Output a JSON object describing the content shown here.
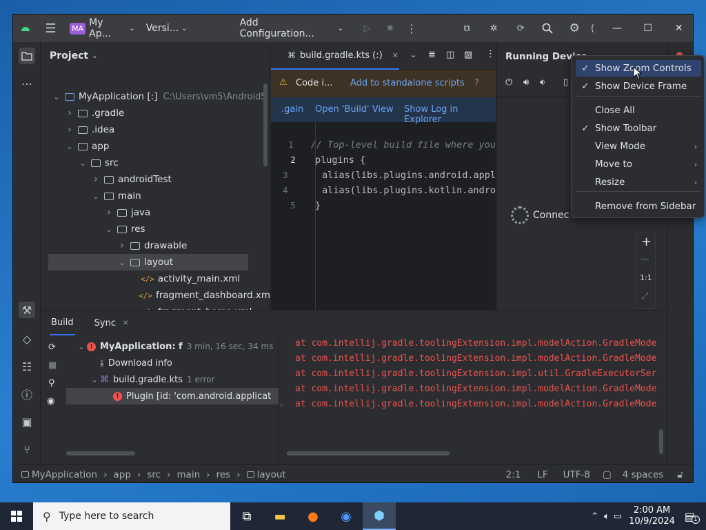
{
  "titlebar": {
    "project_badge": "MA",
    "project_name": "My Ap...",
    "vcs": "Versi...",
    "run_config": "Add Configuration..."
  },
  "project_panel": {
    "title": "Project",
    "root": "MyApplication [:]",
    "root_path": "C:\\Users\\vm5\\AndroidS",
    "items": [
      {
        "label": ".gradle",
        "level": 1,
        "expand": "closed",
        "icon": "folder-icon"
      },
      {
        "label": ".idea",
        "level": 1,
        "expand": "closed",
        "icon": "folder-icon"
      },
      {
        "label": "app",
        "level": 1,
        "expand": "open",
        "icon": "folder-icon"
      },
      {
        "label": "src",
        "level": 2,
        "expand": "open",
        "icon": "folder-icon"
      },
      {
        "label": "androidTest",
        "level": 3,
        "expand": "closed",
        "icon": "folder-icon"
      },
      {
        "label": "main",
        "level": 3,
        "expand": "open",
        "icon": "folder-icon"
      },
      {
        "label": "java",
        "level": 4,
        "expand": "closed",
        "icon": "folder-icon"
      },
      {
        "label": "res",
        "level": 4,
        "expand": "open",
        "icon": "folder-icon"
      },
      {
        "label": "drawable",
        "level": 5,
        "expand": "closed",
        "icon": "folder-icon"
      },
      {
        "label": "layout",
        "level": 5,
        "expand": "open",
        "icon": "folder-icon",
        "selected": true
      },
      {
        "label": "activity_main.xml",
        "level": 6,
        "expand": "none",
        "icon": "xml-icon"
      },
      {
        "label": "fragment_dashboard.xm",
        "level": 6,
        "expand": "none",
        "icon": "xml-icon"
      },
      {
        "label": "fragment_home.xml",
        "level": 6,
        "expand": "none",
        "icon": "xml-icon"
      }
    ]
  },
  "editor": {
    "tab_label": "build.gradle.kts (:)",
    "warning_text": "Code i...",
    "warning_link": "Add to standalone scripts",
    "actions": [
      ".gain",
      "Open 'Build' View",
      "Show Log in Explorer"
    ],
    "lines": [
      {
        "n": "1",
        "code": "// Top-level build file where you",
        "comment": true
      },
      {
        "n": "2",
        "code": "plugins {",
        "comment": false
      },
      {
        "n": "3",
        "code": "    alias(libs.plugins.android.appl",
        "comment": false
      },
      {
        "n": "4",
        "code": "    alias(libs.plugins.kotlin.andro",
        "comment": false
      },
      {
        "n": "5",
        "code": "}",
        "comment": false
      }
    ]
  },
  "running_devices": {
    "title": "Running Device",
    "status": "Connec",
    "zoom_plus": "+",
    "zoom_minus": "—",
    "zoom_actual": "1:1"
  },
  "context_menu": {
    "items": [
      {
        "label": "Show Zoom Controls",
        "checked": true,
        "submenu": false,
        "highlight": true
      },
      {
        "label": "Show Device Frame",
        "checked": true,
        "submenu": false,
        "highlight": false
      },
      {
        "label": "Close All",
        "checked": false,
        "submenu": false,
        "highlight": false
      },
      {
        "label": "Show Toolbar",
        "checked": true,
        "submenu": false,
        "highlight": false
      },
      {
        "label": "View Mode",
        "checked": false,
        "submenu": true,
        "highlight": false
      },
      {
        "label": "Move to",
        "checked": false,
        "submenu": true,
        "highlight": false
      },
      {
        "label": "Resize",
        "checked": false,
        "submenu": true,
        "highlight": false
      },
      {
        "label": "Remove from Sidebar",
        "checked": false,
        "submenu": false,
        "highlight": false
      }
    ]
  },
  "build_panel": {
    "tabs": [
      "Build",
      "Sync"
    ],
    "tree": [
      {
        "label": "MyApplication: f",
        "meta": "3 min, 16 sec, 34 ms",
        "icon": "error-icon",
        "level": 0
      },
      {
        "label": "Download info",
        "meta": "",
        "icon": "download-icon",
        "level": 1
      },
      {
        "label": "build.gradle.kts",
        "meta": "1 error",
        "icon": "gradle-file-icon",
        "level": 1
      },
      {
        "label": "Plugin [id: 'com.android.applicat",
        "meta": "",
        "icon": "error-icon",
        "level": 2
      }
    ],
    "log_lines": [
      "at com.intellij.gradle.toolingExtension.impl.modelAction.GradleMode",
      "at com.intellij.gradle.toolingExtension.impl.modelAction.GradleMode",
      "at com.intellij.gradle.toolingExtension.impl.util.GradleExecutorSer",
      "at com.intellij.gradle.toolingExtension.impl.modelAction.GradleMode",
      "at com.intellij.gradle.toolingExtension.impl.modelAction.GradleMode"
    ]
  },
  "statusbar": {
    "breadcrumb": [
      "MyApplication",
      "app",
      "src",
      "main",
      "res",
      "layout"
    ],
    "position": "2:1",
    "line_sep": "LF",
    "encoding": "UTF-8",
    "indent": "4 spaces"
  },
  "taskbar": {
    "search_placeholder": "Type here to search",
    "time": "2:00 AM",
    "date": "10/9/2024",
    "notif_count": "1"
  },
  "colors": {
    "accent": "#3574f0",
    "error": "#f0524f",
    "selection": "#43454a"
  }
}
